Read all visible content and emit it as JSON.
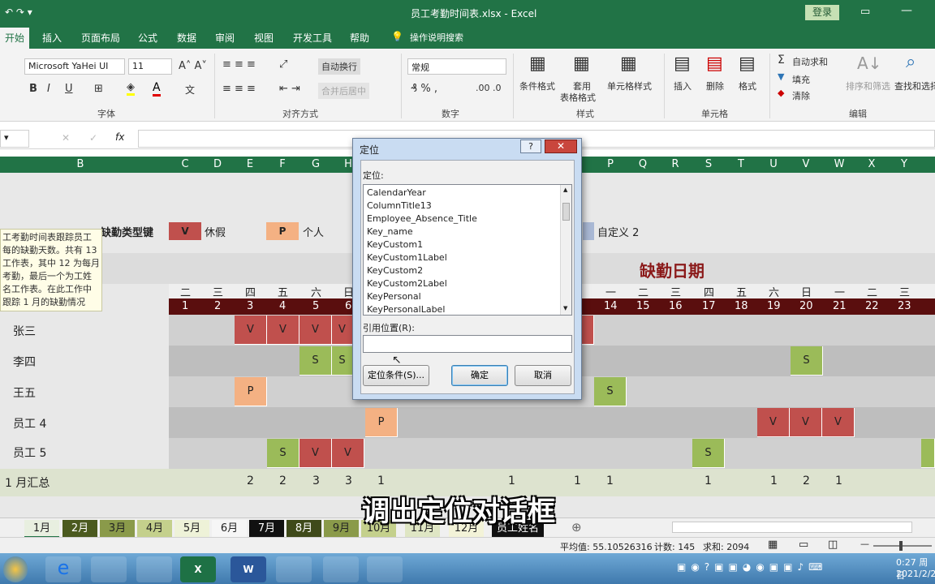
{
  "window": {
    "title": "员工考勤时间表.xlsx - Excel",
    "login": "登录"
  },
  "tabs": [
    "开始",
    "插入",
    "页面布局",
    "公式",
    "数据",
    "审阅",
    "视图",
    "开发工具",
    "帮助",
    "操作说明搜索"
  ],
  "ribbon": {
    "font_name": "Microsoft YaHei UI",
    "font_size": "11",
    "wrap_text": "自动换行",
    "merge_center": "合并后居中",
    "number_format": "常规",
    "cond_format": "条件格式",
    "table_format": "套用\n表格格式",
    "table_format_l1": "套用",
    "table_format_l2": "表格格式",
    "cell_style": "单元格样式",
    "insert": "插入",
    "delete": "删除",
    "format": "格式",
    "autosum": "自动求和",
    "fill": "填充",
    "clear": "清除",
    "sort_filter": "排序和筛选",
    "find_select": "查找和选择",
    "groups": [
      "字体",
      "对齐方式",
      "数字",
      "样式",
      "单元格",
      "编辑"
    ]
  },
  "formula": {
    "fx": "fx"
  },
  "columns": [
    "B",
    "C",
    "D",
    "E",
    "F",
    "G",
    "H",
    "P",
    "Q",
    "R",
    "S",
    "T",
    "U",
    "V",
    "W",
    "X",
    "Y"
  ],
  "legend": {
    "title": "缺勤类型键",
    "v_key": "V",
    "v_label": "休假",
    "p_key": "P",
    "p_label": "个人",
    "custom2": "自定义 2"
  },
  "note": "工考勤时间表跟踪员工每的缺勤天数。共有 13 工作表，其中 12 为每月考勤，最后一个为工姓名工作表。在此工作中跟踪 1 月的缺勤情况",
  "absence_title": "缺勤日期",
  "weekdays_left": [
    "二",
    "三",
    "四",
    "五",
    "六",
    "日"
  ],
  "weekdays_right": [
    "一",
    "二",
    "三",
    "四",
    "五",
    "六",
    "日",
    "一",
    "二",
    "三"
  ],
  "days_left": [
    "1",
    "2",
    "3",
    "4",
    "5",
    "6"
  ],
  "days_right": [
    "14",
    "15",
    "16",
    "17",
    "18",
    "19",
    "20",
    "21",
    "22",
    "23"
  ],
  "employees": [
    "张三",
    "李四",
    "王五",
    "员工 4",
    "员工 5"
  ],
  "total_label": "1 月汇总",
  "totals_left": [
    "2",
    "2",
    "3",
    "3",
    "1"
  ],
  "totals_right": [
    "1",
    "1",
    "1",
    "1",
    "1",
    "2",
    "1"
  ],
  "cell_values": {
    "v": "V",
    "s": "S",
    "p": "P"
  },
  "dialog": {
    "title": "定位",
    "help": "?",
    "goto_label": "定位:",
    "items": [
      "CalendarYear",
      "ColumnTitle13",
      "Employee_Absence_Title",
      "Key_name",
      "KeyCustom1",
      "KeyCustom1Label",
      "KeyCustom2",
      "KeyCustom2Label",
      "KeyPersonal",
      "KeyPersonalLabel"
    ],
    "ref_label": "引用位置(R):",
    "ref_value": "",
    "special_button": "定位条件(S)...",
    "ok_button": "确定",
    "cancel_button": "取消"
  },
  "sheet_tabs": [
    "1月",
    "2月",
    "3月",
    "4月",
    "5月",
    "6月",
    "7月",
    "8月",
    "9月",
    "10月",
    "11月",
    "12月",
    "员工姓名"
  ],
  "status": {
    "average": "平均值: 55.10526316",
    "count": "计数: 145",
    "sum": "求和: 2094"
  },
  "clock": {
    "time": "0:27 周日",
    "date": "2021/2/2"
  },
  "subtitle": "调出定位对话框",
  "colors": {
    "excel_green": "#217346",
    "vacation": "#c0504d",
    "sick": "#9bbb59",
    "personal": "#f4b183"
  }
}
